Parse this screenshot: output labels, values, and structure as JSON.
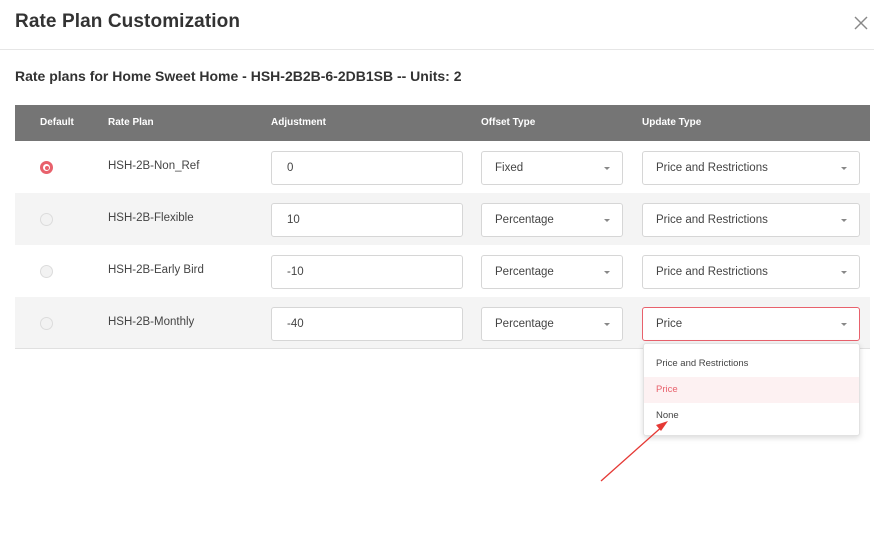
{
  "modal": {
    "title": "Rate Plan Customization",
    "subtitle": "Rate plans for Home Sweet Home - HSH-2B2B-6-2DB1SB -- Units: 2"
  },
  "table": {
    "headers": {
      "default": "Default",
      "rate_plan": "Rate Plan",
      "adjustment": "Adjustment",
      "offset_type": "Offset Type",
      "update_type": "Update Type"
    },
    "rows": [
      {
        "default": true,
        "rate_plan": "HSH-2B-Non_Ref",
        "adjustment": "0",
        "offset_type": "Fixed",
        "update_type": "Price and Restrictions"
      },
      {
        "default": false,
        "rate_plan": "HSH-2B-Flexible",
        "adjustment": "10",
        "offset_type": "Percentage",
        "update_type": "Price and Restrictions"
      },
      {
        "default": false,
        "rate_plan": "HSH-2B-Early Bird",
        "adjustment": "-10",
        "offset_type": "Percentage",
        "update_type": "Price and Restrictions"
      },
      {
        "default": false,
        "rate_plan": "HSH-2B-Monthly",
        "adjustment": "-40",
        "offset_type": "Percentage",
        "update_type": "Price"
      }
    ]
  },
  "update_type_dropdown": {
    "options": [
      "Price and Restrictions",
      "Price",
      "None"
    ],
    "selected": "Price"
  },
  "colors": {
    "accent": "#e8616c",
    "header_bg": "#757575",
    "annotation_arrow": "#e53935"
  },
  "icons": {
    "close": "close-icon",
    "caret": "chevron-down-icon"
  }
}
